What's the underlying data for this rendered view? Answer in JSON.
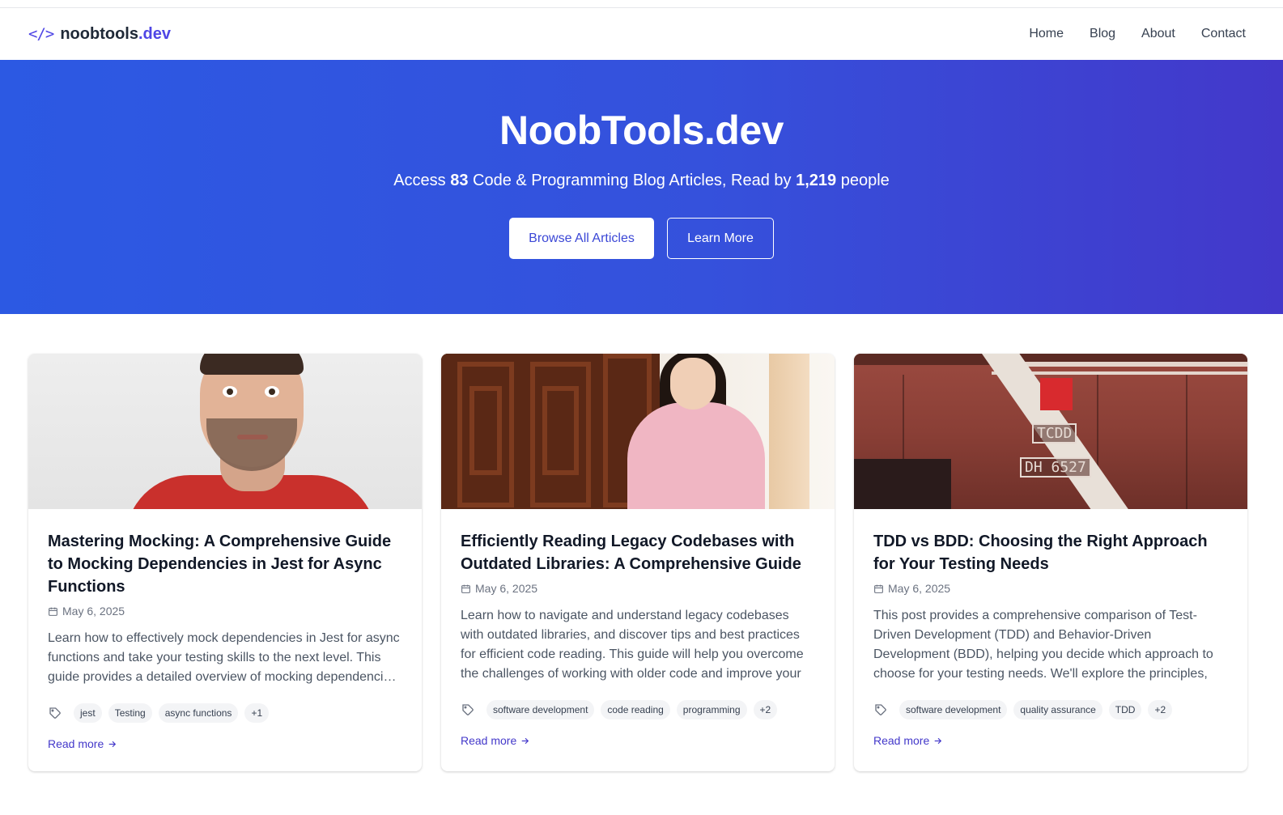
{
  "nav": {
    "brand_icon": "</>",
    "brand_name": "noobtools",
    "brand_tld": ".dev",
    "links": [
      "Home",
      "Blog",
      "About",
      "Contact"
    ]
  },
  "hero": {
    "title": "NoobTools.dev",
    "sub_prefix": "Access ",
    "article_count": "83",
    "sub_middle": " Code & Programming Blog Articles, Read by ",
    "reader_count": "1,219",
    "sub_suffix": " people",
    "primary_button": "Browse All Articles",
    "secondary_button": "Learn More"
  },
  "colors": {
    "accent": "#4f46e5",
    "hero_start": "#2c59e3",
    "hero_end": "#4338ca"
  },
  "icons": {
    "date": "calendar-icon",
    "tags": "tag-icon",
    "read_more": "arrow-right-icon"
  },
  "cards": [
    {
      "title": "Mastering Mocking: A Comprehensive Guide to Mocking Dependencies in Jest for Async Functions",
      "date": "May 6, 2025",
      "excerpt": "Learn how to effectively mock dependencies in Jest for async functions and take your testing skills to the next level. This guide provides a detailed overview of mocking dependencies in Jest for async functions.",
      "tags": [
        "jest",
        "Testing",
        "async functions",
        "+1"
      ],
      "read_more": "Read more"
    },
    {
      "title": "Efficiently Reading Legacy Codebases with Outdated Libraries: A Comprehensive Guide",
      "date": "May 6, 2025",
      "excerpt": "Learn how to navigate and understand legacy codebases with outdated libraries, and discover tips and best practices for efficient code reading. This guide will help you overcome the challenges of working with older code and improve your",
      "tags": [
        "software development",
        "code reading",
        "programming",
        "+2"
      ],
      "read_more": "Read more"
    },
    {
      "title": "TDD vs BDD: Choosing the Right Approach for Your Testing Needs",
      "date": "May 6, 2025",
      "excerpt": "This post provides a comprehensive comparison of Test-Driven Development (TDD) and Behavior-Driven Development (BDD), helping you decide which approach to choose for your testing needs. We'll explore the principles,",
      "tags": [
        "software development",
        "quality assurance",
        "TDD",
        "+2"
      ],
      "read_more": "Read more"
    }
  ],
  "image_texts": {
    "plate_top": "TCDD",
    "plate_bottom": "DH 6527"
  }
}
